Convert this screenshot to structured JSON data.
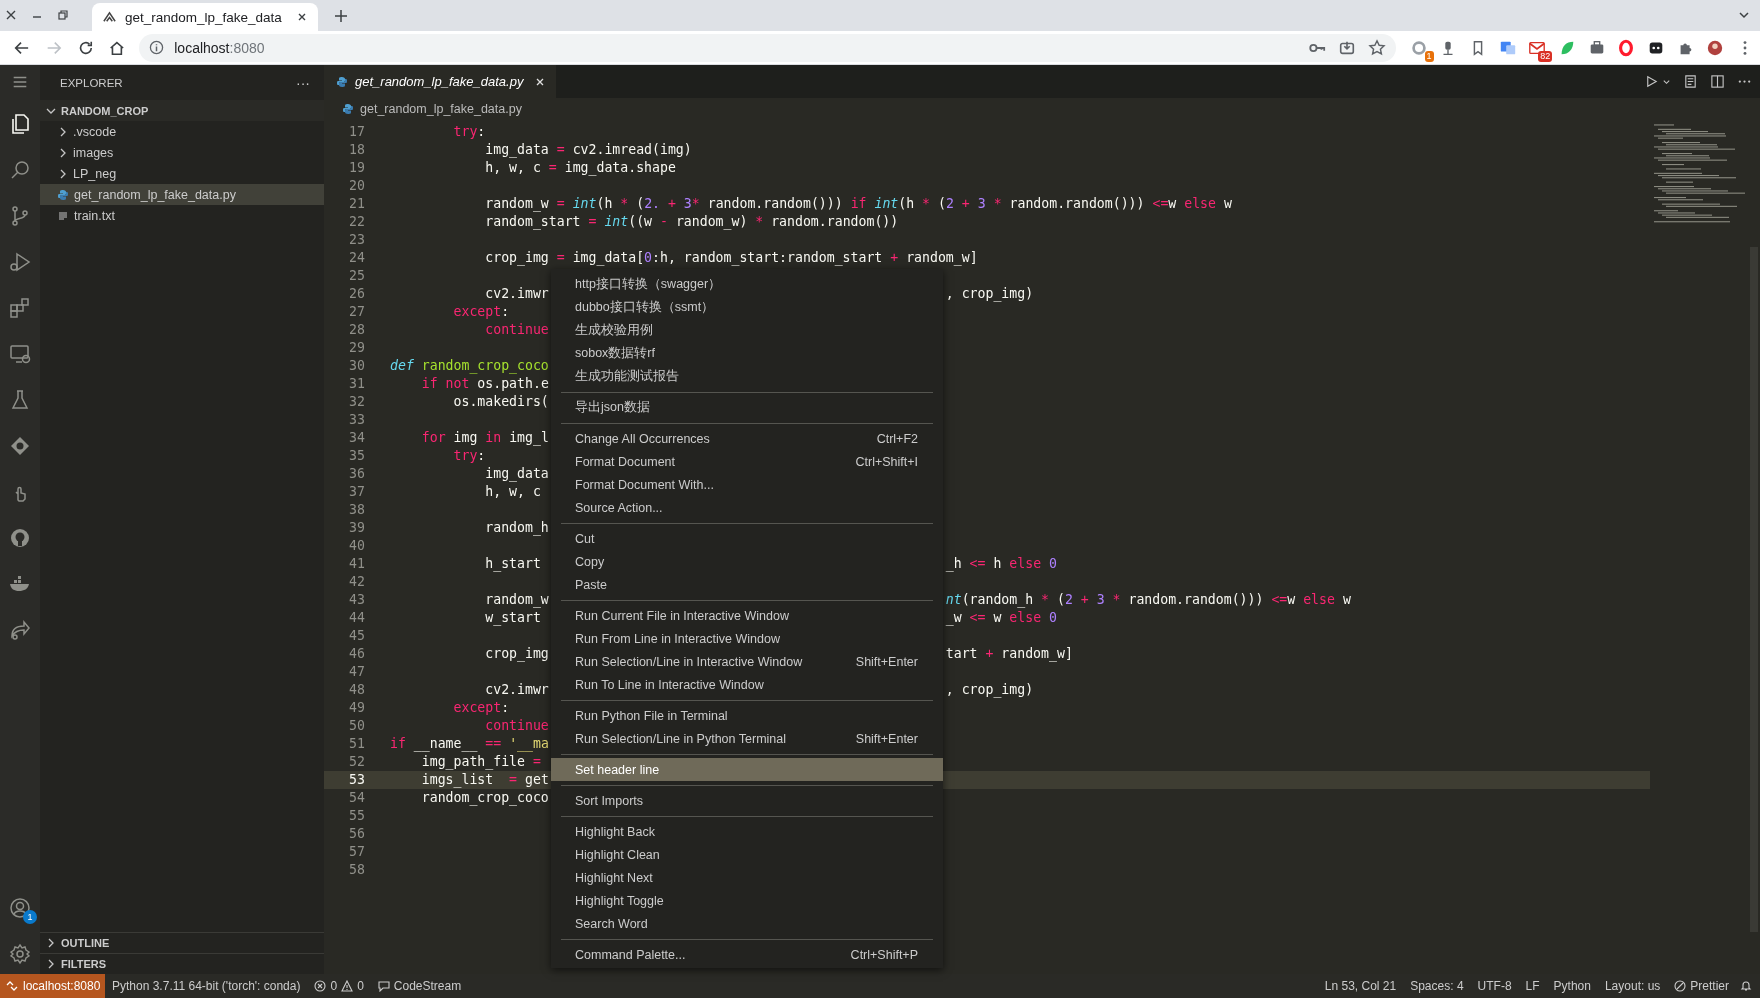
{
  "browser": {
    "tab": {
      "title": "get_random_lp_fake_data"
    },
    "address": {
      "host": "localhost",
      "port": ":8080"
    },
    "extension_badges": [
      {
        "text": "1",
        "color": "#e8710a"
      },
      {
        "text": "82",
        "color": "#d93025"
      }
    ]
  },
  "activity_bar": {
    "account_badge": "1"
  },
  "explorer": {
    "title": "EXPLORER",
    "more": "···",
    "tree": [
      {
        "label": "RANDOM_CROP",
        "kind": "root",
        "expanded": true,
        "selected": false,
        "children": [
          {
            "label": ".vscode",
            "kind": "folder",
            "expanded": false,
            "selected": false
          },
          {
            "label": "images",
            "kind": "folder",
            "expanded": false,
            "selected": false
          },
          {
            "label": "LP_neg",
            "kind": "folder",
            "expanded": false,
            "selected": false
          },
          {
            "label": "get_random_lp_fake_data.py",
            "kind": "python",
            "selected": true
          },
          {
            "label": "train.txt",
            "kind": "text",
            "selected": false
          }
        ]
      }
    ],
    "sections": [
      {
        "label": "OUTLINE",
        "expanded": false
      },
      {
        "label": "FILTERS",
        "expanded": false
      }
    ]
  },
  "editor": {
    "tabs": [
      {
        "label": "get_random_lp_fake_data.py",
        "selected": true,
        "preview": true
      }
    ],
    "breadcrumb": "get_random_lp_fake_data.py",
    "lines": [
      {
        "n": "17",
        "current": false,
        "left": [
          {
            "text": "        try",
            "kind": "kw"
          },
          {
            "text": ":",
            "kind": "p"
          }
        ]
      },
      {
        "n": "18",
        "current": false,
        "left": [
          {
            "text": "            img_data ",
            "kind": "p"
          },
          {
            "text": "= ",
            "kind": "op"
          },
          {
            "text": "cv2.imread(img)",
            "kind": "p"
          }
        ]
      },
      {
        "n": "19",
        "current": false,
        "left": [
          {
            "text": "            h, w, c ",
            "kind": "p"
          },
          {
            "text": "= ",
            "kind": "op"
          },
          {
            "text": "img_data.shape",
            "kind": "p"
          }
        ]
      },
      {
        "n": "20",
        "current": false
      },
      {
        "n": "21",
        "current": false,
        "left": [
          {
            "text": "            random_w ",
            "kind": "p"
          },
          {
            "text": "= ",
            "kind": "op"
          },
          {
            "text": "int",
            "kind": "fn"
          },
          {
            "text": "(h ",
            "kind": "p"
          },
          {
            "text": "* ",
            "kind": "op"
          },
          {
            "text": "(",
            "kind": "p"
          },
          {
            "text": "2. ",
            "kind": "num"
          },
          {
            "text": "+ ",
            "kind": "op"
          },
          {
            "text": "3",
            "kind": "num"
          },
          {
            "text": "* ",
            "kind": "op"
          },
          {
            "text": "random.random())) ",
            "kind": "p"
          },
          {
            "text": "if ",
            "kind": "kw"
          },
          {
            "text": "int",
            "kind": "fn"
          },
          {
            "text": "(h ",
            "kind": "p"
          },
          {
            "text": "* ",
            "kind": "op"
          },
          {
            "text": "(",
            "kind": "p"
          },
          {
            "text": "2 ",
            "kind": "num"
          },
          {
            "text": "+ ",
            "kind": "op"
          },
          {
            "text": "3 ",
            "kind": "num"
          },
          {
            "text": "* ",
            "kind": "op"
          },
          {
            "text": "random.random())) ",
            "kind": "p"
          },
          {
            "text": "<=",
            "kind": "op"
          },
          {
            "text": "w ",
            "kind": "p"
          },
          {
            "text": "else ",
            "kind": "kw"
          },
          {
            "text": "w",
            "kind": "p"
          }
        ]
      },
      {
        "n": "22",
        "current": false,
        "left": [
          {
            "text": "            random_start ",
            "kind": "p"
          },
          {
            "text": "= ",
            "kind": "op"
          },
          {
            "text": "int",
            "kind": "fn"
          },
          {
            "text": "((w ",
            "kind": "p"
          },
          {
            "text": "- ",
            "kind": "op"
          },
          {
            "text": "random_w) ",
            "kind": "p"
          },
          {
            "text": "* ",
            "kind": "op"
          },
          {
            "text": "random.random())",
            "kind": "p"
          }
        ]
      },
      {
        "n": "23",
        "current": false
      },
      {
        "n": "24",
        "current": false,
        "left": [
          {
            "text": "            crop_img ",
            "kind": "p"
          },
          {
            "text": "= ",
            "kind": "op"
          },
          {
            "text": "img_data[",
            "kind": "p"
          },
          {
            "text": "0",
            "kind": "num"
          },
          {
            "text": ":h, random_start:random_start ",
            "kind": "p"
          },
          {
            "text": "+ ",
            "kind": "op"
          },
          {
            "text": "random_w]",
            "kind": "p"
          }
        ]
      },
      {
        "n": "25",
        "current": false
      },
      {
        "n": "26",
        "current": false,
        "left": [
          {
            "text": "            cv2.imwr",
            "kind": "p"
          }
        ],
        "right": [
          {
            "text": ", crop_img)",
            "kind": "p"
          }
        ]
      },
      {
        "n": "27",
        "current": false,
        "left": [
          {
            "text": "        except",
            "kind": "kw"
          },
          {
            "text": ":",
            "kind": "p"
          }
        ]
      },
      {
        "n": "28",
        "current": false,
        "left": [
          {
            "text": "            continue",
            "kind": "kw"
          }
        ]
      },
      {
        "n": "29",
        "current": false
      },
      {
        "n": "30",
        "current": false,
        "left": [
          {
            "text": "def ",
            "kind": "st"
          },
          {
            "text": "random_crop_coco",
            "kind": "def"
          }
        ]
      },
      {
        "n": "31",
        "current": false,
        "left": [
          {
            "text": "    if ",
            "kind": "kw"
          },
          {
            "text": "not ",
            "kind": "kw"
          },
          {
            "text": "os.path.e",
            "kind": "p"
          }
        ]
      },
      {
        "n": "32",
        "current": false,
        "left": [
          {
            "text": "        os.makedirs(",
            "kind": "p"
          }
        ]
      },
      {
        "n": "33",
        "current": false
      },
      {
        "n": "34",
        "current": false,
        "left": [
          {
            "text": "    for ",
            "kind": "kw"
          },
          {
            "text": "img ",
            "kind": "p"
          },
          {
            "text": "in ",
            "kind": "kw"
          },
          {
            "text": "img_l",
            "kind": "p"
          }
        ]
      },
      {
        "n": "35",
        "current": false,
        "left": [
          {
            "text": "        try",
            "kind": "kw"
          },
          {
            "text": ":",
            "kind": "p"
          }
        ]
      },
      {
        "n": "36",
        "current": false,
        "left": [
          {
            "text": "            img_data",
            "kind": "p"
          }
        ]
      },
      {
        "n": "37",
        "current": false,
        "left": [
          {
            "text": "            h, w, c",
            "kind": "p"
          }
        ]
      },
      {
        "n": "38",
        "current": false
      },
      {
        "n": "39",
        "current": false,
        "left": [
          {
            "text": "            random_h",
            "kind": "p"
          }
        ]
      },
      {
        "n": "40",
        "current": false
      },
      {
        "n": "41",
        "current": false,
        "left": [
          {
            "text": "            h_start",
            "kind": "p"
          }
        ],
        "right": [
          {
            "text": "_h ",
            "kind": "p"
          },
          {
            "text": "<= ",
            "kind": "op"
          },
          {
            "text": "h ",
            "kind": "p"
          },
          {
            "text": "else ",
            "kind": "kw"
          },
          {
            "text": "0",
            "kind": "num"
          }
        ]
      },
      {
        "n": "42",
        "current": false
      },
      {
        "n": "43",
        "current": false,
        "left": [
          {
            "text": "            random_w",
            "kind": "p"
          }
        ],
        "right": [
          {
            "text": "nt",
            "kind": "fn"
          },
          {
            "text": "(random_h ",
            "kind": "p"
          },
          {
            "text": "* ",
            "kind": "op"
          },
          {
            "text": "(",
            "kind": "p"
          },
          {
            "text": "2 ",
            "kind": "num"
          },
          {
            "text": "+ ",
            "kind": "op"
          },
          {
            "text": "3 ",
            "kind": "num"
          },
          {
            "text": "* ",
            "kind": "op"
          },
          {
            "text": "random.random())) ",
            "kind": "p"
          },
          {
            "text": "<=",
            "kind": "op"
          },
          {
            "text": "w ",
            "kind": "p"
          },
          {
            "text": "else ",
            "kind": "kw"
          },
          {
            "text": "w",
            "kind": "p"
          }
        ]
      },
      {
        "n": "44",
        "current": false,
        "left": [
          {
            "text": "            w_start",
            "kind": "p"
          }
        ],
        "right": [
          {
            "text": "_w ",
            "kind": "p"
          },
          {
            "text": "<= ",
            "kind": "op"
          },
          {
            "text": "w ",
            "kind": "p"
          },
          {
            "text": "else ",
            "kind": "kw"
          },
          {
            "text": "0",
            "kind": "num"
          }
        ]
      },
      {
        "n": "45",
        "current": false
      },
      {
        "n": "46",
        "current": false,
        "left": [
          {
            "text": "            crop_img",
            "kind": "p"
          }
        ],
        "right": [
          {
            "text": "tart ",
            "kind": "p"
          },
          {
            "text": "+ ",
            "kind": "op"
          },
          {
            "text": "random_w]",
            "kind": "p"
          }
        ]
      },
      {
        "n": "47",
        "current": false
      },
      {
        "n": "48",
        "current": false,
        "left": [
          {
            "text": "            cv2.imwr",
            "kind": "p"
          }
        ],
        "right": [
          {
            "text": ", crop_img)",
            "kind": "p"
          }
        ]
      },
      {
        "n": "49",
        "current": false,
        "left": [
          {
            "text": "        except",
            "kind": "kw"
          },
          {
            "text": ":",
            "kind": "p"
          }
        ]
      },
      {
        "n": "50",
        "current": false,
        "left": [
          {
            "text": "            continue",
            "kind": "kw"
          }
        ]
      },
      {
        "n": "51",
        "current": false,
        "left": [
          {
            "text": "if ",
            "kind": "kw"
          },
          {
            "text": "__name__ ",
            "kind": "p"
          },
          {
            "text": "== ",
            "kind": "op"
          },
          {
            "text": "'__ma",
            "kind": "str"
          }
        ]
      },
      {
        "n": "52",
        "current": false,
        "left": [
          {
            "text": "    img_path_file ",
            "kind": "p"
          },
          {
            "text": "=",
            "kind": "op"
          }
        ]
      },
      {
        "n": "53",
        "current": true,
        "left": [
          {
            "text": "    imgs_list  ",
            "kind": "p"
          },
          {
            "text": "= ",
            "kind": "op"
          },
          {
            "text": "get",
            "kind": "p"
          }
        ]
      },
      {
        "n": "54",
        "current": false,
        "left": [
          {
            "text": "    random_crop_coco",
            "kind": "p"
          }
        ]
      },
      {
        "n": "55",
        "current": false
      },
      {
        "n": "56",
        "current": false
      },
      {
        "n": "57",
        "current": false
      },
      {
        "n": "58",
        "current": false
      }
    ]
  },
  "context_menu": {
    "items": [
      {
        "kind": "item",
        "label": "http接口转换（swagger）",
        "selected": false
      },
      {
        "kind": "item",
        "label": "dubbo接口转换（ssmt）",
        "selected": false
      },
      {
        "kind": "item",
        "label": "生成校验用例",
        "selected": false
      },
      {
        "kind": "item",
        "label": "sobox数据转rf",
        "selected": false
      },
      {
        "kind": "item",
        "label": "生成功能测试报告",
        "selected": false
      },
      {
        "kind": "separator"
      },
      {
        "kind": "item",
        "label": "导出json数据",
        "selected": false
      },
      {
        "kind": "separator"
      },
      {
        "kind": "item",
        "label": "Change All Occurrences",
        "shortcut": "Ctrl+F2",
        "selected": false
      },
      {
        "kind": "item",
        "label": "Format Document",
        "shortcut": "Ctrl+Shift+I",
        "selected": false
      },
      {
        "kind": "item",
        "label": "Format Document With...",
        "selected": false
      },
      {
        "kind": "item",
        "label": "Source Action...",
        "selected": false
      },
      {
        "kind": "separator"
      },
      {
        "kind": "item",
        "label": "Cut",
        "selected": false
      },
      {
        "kind": "item",
        "label": "Copy",
        "selected": false
      },
      {
        "kind": "item",
        "label": "Paste",
        "selected": false
      },
      {
        "kind": "separator"
      },
      {
        "kind": "item",
        "label": "Run Current File in Interactive Window",
        "selected": false
      },
      {
        "kind": "item",
        "label": "Run From Line in Interactive Window",
        "selected": false
      },
      {
        "kind": "item",
        "label": "Run Selection/Line in Interactive Window",
        "shortcut": "Shift+Enter",
        "selected": false
      },
      {
        "kind": "item",
        "label": "Run To Line in Interactive Window",
        "selected": false
      },
      {
        "kind": "separator"
      },
      {
        "kind": "item",
        "label": "Run Python File in Terminal",
        "selected": false
      },
      {
        "kind": "item",
        "label": "Run Selection/Line in Python Terminal",
        "shortcut": "Shift+Enter",
        "selected": false
      },
      {
        "kind": "separator"
      },
      {
        "kind": "item",
        "label": "Set header line",
        "selected": true
      },
      {
        "kind": "separator"
      },
      {
        "kind": "item",
        "label": "Sort Imports",
        "selected": false
      },
      {
        "kind": "separator"
      },
      {
        "kind": "item",
        "label": "Highlight Back",
        "selected": false
      },
      {
        "kind": "item",
        "label": "Highlight Clean",
        "selected": false
      },
      {
        "kind": "item",
        "label": "Highlight Next",
        "selected": false
      },
      {
        "kind": "item",
        "label": "Highlight Toggle",
        "selected": false
      },
      {
        "kind": "item",
        "label": "Search Word",
        "selected": false
      },
      {
        "kind": "separator"
      },
      {
        "kind": "item",
        "label": "Command Palette...",
        "shortcut": "Ctrl+Shift+P",
        "selected": false
      }
    ]
  },
  "status_bar": {
    "remote": "localhost:8080",
    "left": [
      {
        "kind": "text",
        "text": "Python 3.7.11 64-bit ('torch': conda)"
      },
      {
        "kind": "problems",
        "errors": "0",
        "warnings": "0"
      },
      {
        "kind": "codestream",
        "text": "CodeStream"
      }
    ],
    "right": [
      {
        "kind": "text",
        "text": "Ln 53, Col 21"
      },
      {
        "kind": "text",
        "text": "Spaces: 4"
      },
      {
        "kind": "text",
        "text": "UTF-8"
      },
      {
        "kind": "text",
        "text": "LF"
      },
      {
        "kind": "text",
        "text": "Python"
      },
      {
        "kind": "text",
        "text": "Layout: us"
      },
      {
        "kind": "prettier",
        "text": "Prettier"
      },
      {
        "kind": "bell"
      }
    ]
  }
}
